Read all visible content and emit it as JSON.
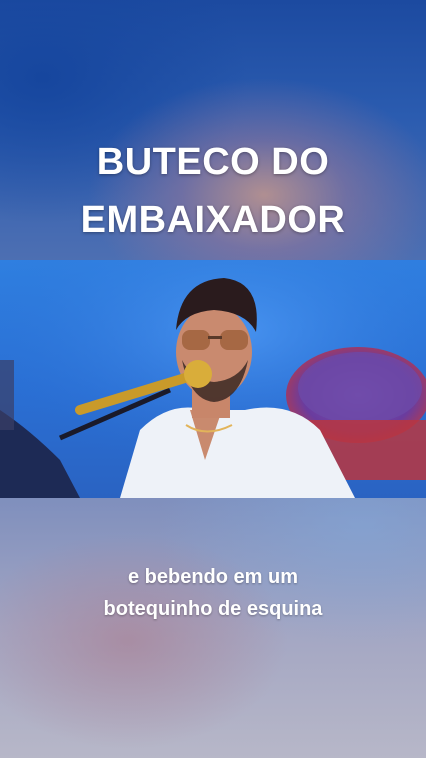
{
  "overlay": {
    "title_lines": [
      "BUTECO DO",
      "EMBAIXADOR"
    ]
  },
  "video": {
    "description_icon": "performer-singing-at-microphone"
  },
  "subtitle": {
    "lines": [
      "e bebendo em um",
      "botequinho de esquina"
    ]
  },
  "colors": {
    "stage_blue": "#2f7fe0",
    "top_blue": "#1c4aa0",
    "text": "#ffffff"
  }
}
